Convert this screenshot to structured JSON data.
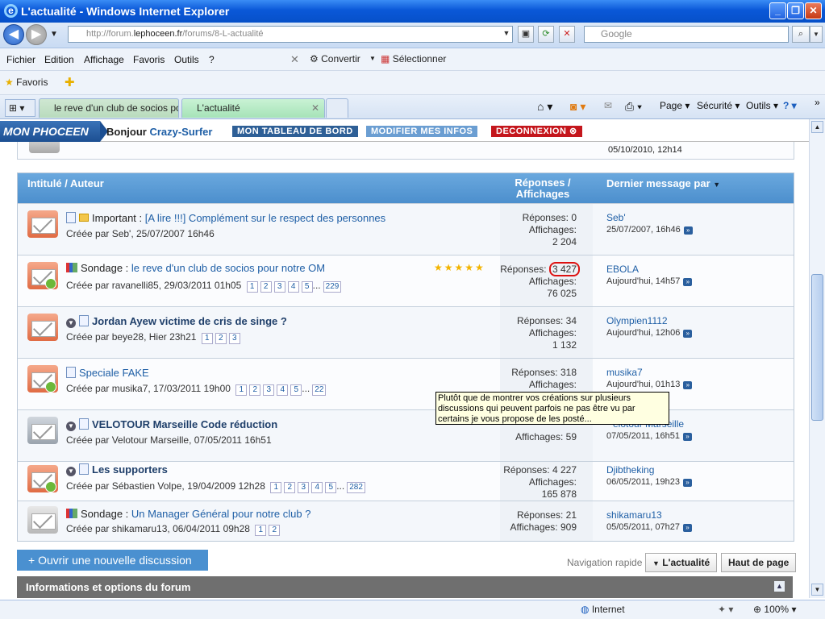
{
  "window": {
    "title": "L'actualité - Windows Internet Explorer"
  },
  "address": {
    "url_prefix": "http://forum.",
    "url_domain": "lephoceen.fr",
    "url_path": "/forums/8-L-actualité",
    "search_placeholder": "Google"
  },
  "menu": [
    "Fichier",
    "Edition",
    "Affichage",
    "Favoris",
    "Outils",
    "?"
  ],
  "toolbar": {
    "convert": "Convertir",
    "select": "Sélectionner",
    "favorites": "Favoris"
  },
  "tabs": [
    {
      "label": "le reve d'un club de socios po..."
    },
    {
      "label": "L'actualité"
    }
  ],
  "commands": {
    "page": "Page",
    "security": "Sécurité",
    "tools": "Outils"
  },
  "phoceen": {
    "logo": "MON PHOCEEN",
    "hello": "Bonjour ",
    "user": "Crazy-Surfer",
    "dashboard": "MON TABLEAU DE BORD",
    "edit": "MODIFIER MES INFOS",
    "logout": "DECONNEXION"
  },
  "prev_date": "05/10/2010, 12h14",
  "table": {
    "col_title": "Intitulé / Auteur",
    "col_stats": "Réponses / Affichages",
    "col_last": "Dernier message par"
  },
  "threads": [
    {
      "prefix": "Important : ",
      "title": "[A lire !!!] Complément sur le respect des personnes",
      "author": "Créée par Seb', 25/07/2007 16h46",
      "pages": [],
      "replies": "Réponses: 0",
      "views_label": "Affichages:",
      "views": "2 204",
      "last_user": "Seb'",
      "last_date": "25/07/2007, 16h46"
    },
    {
      "prefix": "Sondage : ",
      "title": "le reve d'un club de socios pour notre OM",
      "author": "Créée par ravanelli85, 29/03/2011 01h05",
      "pages": [
        "1",
        "2",
        "3",
        "4",
        "5",
        "...",
        "229"
      ],
      "replies_label": "Réponses: ",
      "replies_num": "3 427",
      "views_label": "Affichages:",
      "views": "76 025",
      "last_user": "EBOLA",
      "last_date": "Aujourd'hui, 14h57"
    },
    {
      "prefix": "",
      "title": "Jordan Ayew victime de cris de singe ?",
      "author": "Créée par beye28, Hier 23h21",
      "pages": [
        "1",
        "2",
        "3"
      ],
      "replies": "Réponses: 34",
      "views_label": "Affichages:",
      "views": "1 132",
      "last_user": "Olympien1112",
      "last_date": "Aujourd'hui, 12h06"
    },
    {
      "prefix": "",
      "title": "Speciale FAKE",
      "author": "Créée par musika7, 17/03/2011 19h00",
      "pages": [
        "1",
        "2",
        "3",
        "4",
        "5",
        "...",
        "22"
      ],
      "replies": "Réponses: 318",
      "views_label": "Affichages:",
      "views": "",
      "last_user": "musika7",
      "last_date": "Aujourd'hui, 01h13"
    },
    {
      "prefix": "",
      "title": "VELOTOUR Marseille Code réduction",
      "author": "Créée par Velotour Marseille, 07/05/2011 16h51",
      "pages": [],
      "replies": "",
      "views_label": "Affichages: 59",
      "views": "",
      "last_user": "elotour Marseille",
      "last_date": "07/05/2011, 16h51"
    },
    {
      "prefix": "",
      "title": "Les supporters",
      "author": "Créée par Sébastien Volpe, 19/04/2009 12h28",
      "pages": [
        "1",
        "2",
        "3",
        "4",
        "5",
        "...",
        "282"
      ],
      "replies": "Réponses: 4 227",
      "views_label": "Affichages:",
      "views": "165 878",
      "last_user": "Djibtheking",
      "last_date": "06/05/2011, 19h23"
    },
    {
      "prefix": "Sondage : ",
      "title": "Un Manager Général pour notre club ?",
      "author": "Créée par shikamaru13, 06/04/2011 09h28",
      "pages": [
        "1",
        "2"
      ],
      "replies": "Réponses: 21",
      "views_label": "Affichages: 909",
      "views": "",
      "last_user": "shikamaru13",
      "last_date": "05/05/2011, 07h27"
    }
  ],
  "tooltip": "Plutôt que de montrer vos créations sur plusieurs discussions qui peuvent parfois ne pas être vu par certains je vous propose de les posté...",
  "footer": {
    "new_discussion": "+ Ouvrir une nouvelle discussion",
    "quick_nav": "Navigation rapide",
    "forum_jump": "L'actualité",
    "top": "Haut de page",
    "info": "Informations et options du forum"
  },
  "status": {
    "zone": "Internet",
    "zoom": "100%"
  }
}
